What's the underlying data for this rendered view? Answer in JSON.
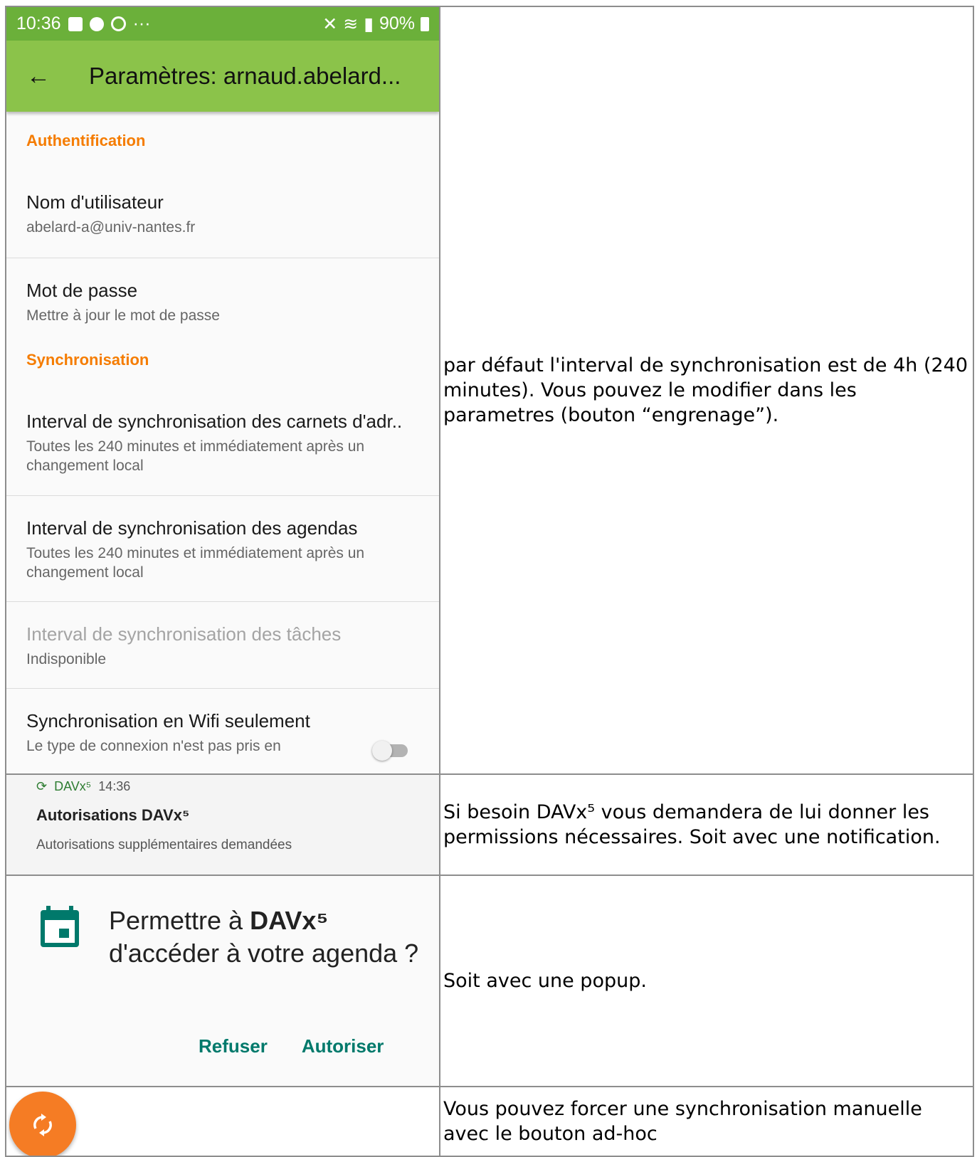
{
  "row1": {
    "status_bar": {
      "time": "10:36",
      "dots": "···",
      "battery": "90%"
    },
    "app_bar": {
      "back_icon": "arrow-left",
      "title": "Paramètres: arnaud.abelard..."
    },
    "sections": {
      "auth_header": "Authentification",
      "username_title": "Nom d'utilisateur",
      "username_value": "abelard-a@univ-nantes.fr",
      "password_title": "Mot de passe",
      "password_summary": "Mettre à jour le mot de passe",
      "sync_header": "Synchronisation",
      "contacts_interval_title": "Interval de synchronisation des carnets d'adr..",
      "contacts_interval_summary": "Toutes les 240 minutes et immédiatement après un changement local",
      "calendars_interval_title": "Interval de synchronisation des agendas",
      "calendars_interval_summary": "Toutes les 240 minutes et immédiatement après un changement local",
      "tasks_interval_title": "Interval de synchronisation des tâches",
      "tasks_interval_summary": "Indisponible",
      "wifi_title": "Synchronisation en Wifi seulement",
      "wifi_summary": "Le type de connexion n'est pas pris en"
    },
    "note": "par défaut l'interval de synchronisation est de 4h (240 minutes). Vous pouvez le modifier dans les parametres (bouton “engrenage”)."
  },
  "row2": {
    "notification": {
      "app_name": "DAVx⁵",
      "time": "14:36",
      "title": "Autorisations DAVx⁵",
      "text": "Autorisations supplémentaires demandées"
    },
    "note": "Si besoin DAVx⁵ vous demandera de lui donner les permissions nécessaires. Soit avec une notification."
  },
  "row3": {
    "dialog": {
      "title_prefix": "Permettre à ",
      "title_app": "DAVx⁵",
      "title_suffix": " d'accéder à votre agenda ?",
      "refuse": "Refuser",
      "allow": "Autoriser"
    },
    "note": "Soit avec une popup."
  },
  "row4": {
    "fab_icon": "sync-icon",
    "note": "Vous pouvez forcer une synchronisation manuelle avec le bouton ad-hoc"
  },
  "colors": {
    "status_bar": "#6bb03a",
    "app_bar": "#8bc34a",
    "category": "#f57c00",
    "dialog_button": "#00796b",
    "fab": "#f57c24"
  }
}
